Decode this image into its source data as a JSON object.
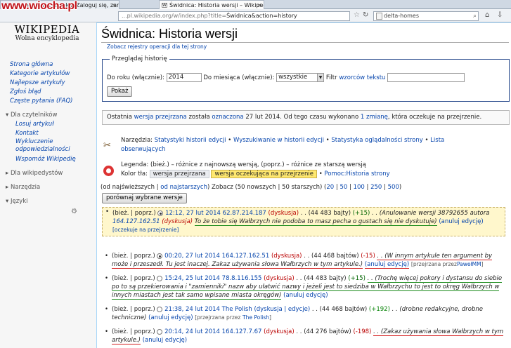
{
  "watermark": "www.wiocha.pl",
  "browser": {
    "tabs": [
      {
        "label": "Witamy na Facebooku. Zaloguj się, zarej..."
      },
      {
        "label": "Świdnica: Historia wersji – Wikipedia, wol..."
      }
    ],
    "url_prefix": "...pl.wikipedia.org/w/index.php?title=",
    "url_rest": "Świdnica&action=history",
    "search_value": "delta-homes"
  },
  "logo": {
    "title": "Wikipedia",
    "subtitle": "Wolna encyklopedia"
  },
  "sidebar": {
    "main": [
      "Strona główna",
      "Kategorie artykułów",
      "Najlepsze artykuły",
      "Zgłoś błąd",
      "Częste pytania (FAQ)"
    ],
    "readers_heading": "Dla czytelników",
    "readers": [
      "Losuj artykuł",
      "Kontakt",
      "Wykluczenie odpowiedzialności",
      "Wspomóż Wikipedię"
    ],
    "wikipedians_heading": "Dla wikipedystów",
    "tools_heading": "Narzędzia",
    "languages_heading": "Języki"
  },
  "page": {
    "title": "Świdnica: Historia wersji",
    "log_link": "Zobacz rejestry operacji dla tej strony"
  },
  "browse": {
    "legend": "Przeglądaj historię",
    "year_label": "Do roku (włącznie):",
    "year_value": "2014",
    "month_label": "Do miesiąca (włącznie):",
    "month_value": "wszystkie",
    "filter_label": "Filtr",
    "filter_link": "wzorców tekstu",
    "submit": "Pokaż"
  },
  "notice": {
    "a": "Ostatnia",
    "b": "wersja przejrzana",
    "c": "została",
    "d": "oznaczona",
    "e": "27 lut 2014. Od tego czasu wykonano",
    "f": "1 zmianę",
    "g": ", która oczekuje na przejrzenie."
  },
  "tools": {
    "label": "Narzędzia:",
    "links": [
      "Statystyki historii edycji",
      "Wyszukiwanie w historii edycji",
      "Statystyka oglądalności strony",
      "Lista obserwujących"
    ]
  },
  "legend": {
    "line1": "Legenda: (bież.) – różnice z najnowszą wersją, (poprz.) – różnice ze starszą wersją",
    "bg_label": "Kolor tła:",
    "bg1": "wersja przejrzana",
    "bg2": "wersja oczekująca na przejrzenie",
    "help": "Pomoc:Historia strony"
  },
  "nav": {
    "a": "(od najświeższych |",
    "b": "od najstarszych",
    "c": ") Zobacz (50 nowszych | 50 starszych) (",
    "n20": "20",
    "n50": "50",
    "n100": "100",
    "n250": "250",
    "n500": "500",
    "close": ")",
    "compare_button": "porównaj wybrane wersje"
  },
  "history": [
    {
      "diff": "(bież. | poprz.)",
      "date": "12:12, 27 lut 2014",
      "user": "62.87.214.187",
      "talk": "(dyskusja)",
      "size": ". . (44 483 bajty)",
      "delta": "(+15)",
      "summary_a": ". . (Anulowanie wersji 38792655 autora",
      "summary_ip": "164.127.162.51",
      "summary_talk": "(dyskusja)",
      "summary_b": "To że tobie się Wałbrzych nie podoba to masz pecha o gustach się nie dyskutuje)",
      "undo": "(anuluj edycję)",
      "pending": "[oczekuje na przejrzenie]"
    },
    {
      "diff": "(bież. | poprz.)",
      "date": "00:20, 27 lut 2014",
      "user": "164.127.162.51",
      "talk": "(dyskusja)",
      "size": ". . (44 468 bajtów)",
      "delta": "(-15)",
      "summary": ". . (W innym artykule ten argument by może i przeszedł. Tu jest inaczej. Zakaz używania słowa Wałbrzych w tym artykule.)",
      "undo": "(anuluj edycję)",
      "reviewed": "[przejrzana przez",
      "reviewer": "PawełMM",
      "reviewed_end": "]"
    },
    {
      "diff": "(bież. | poprz.)",
      "date": "15:24, 25 lut 2014",
      "user": "78.8.116.155",
      "talk": "(dyskusja)",
      "size": ". . (44 483 bajty)",
      "delta": "(+15)",
      "summary": ". . (Trochę więcej pokory i dystansu do siebie po to są przekierowania i \"zamienniki\" nazw aby ułatwić nazwy i jeżeli jest to siedziba w Wałbrzychu to jest to okręg Wałbrzych w innych miastach jest tak samo wpisane miasta okręgów)",
      "undo": "(anuluj edycję)"
    },
    {
      "diff": "(bież. | poprz.)",
      "date": "21:38, 24 lut 2014",
      "user": "The Polish",
      "talk": "(dyskusja | edycje)",
      "size": ". . (44 468 bajtów)",
      "delta": "(+192)",
      "summary": ". . (drobne redakcyjne, drobne techniczne)",
      "undo": "(anuluj edycję)",
      "reviewed": "[przejrzana przez",
      "reviewer": "The Polish",
      "reviewed_end": "]"
    },
    {
      "diff": "(bież. | poprz.)",
      "date": "20:14, 24 lut 2014",
      "user": "164.127.7.67",
      "talk": "(dyskusja)",
      "size": ". . (44 276 bajtów)",
      "delta": "(-198)",
      "summary": ". . (Zakaz używania słowa Wałbrzych w tym artykule.)",
      "undo": "(anuluj edycję)"
    }
  ],
  "colors": {
    "link": "#0645ad",
    "red_marker": "#d41e1e",
    "green_marker": "#1a8a1a",
    "flagged_bg": "#fff7cc"
  }
}
